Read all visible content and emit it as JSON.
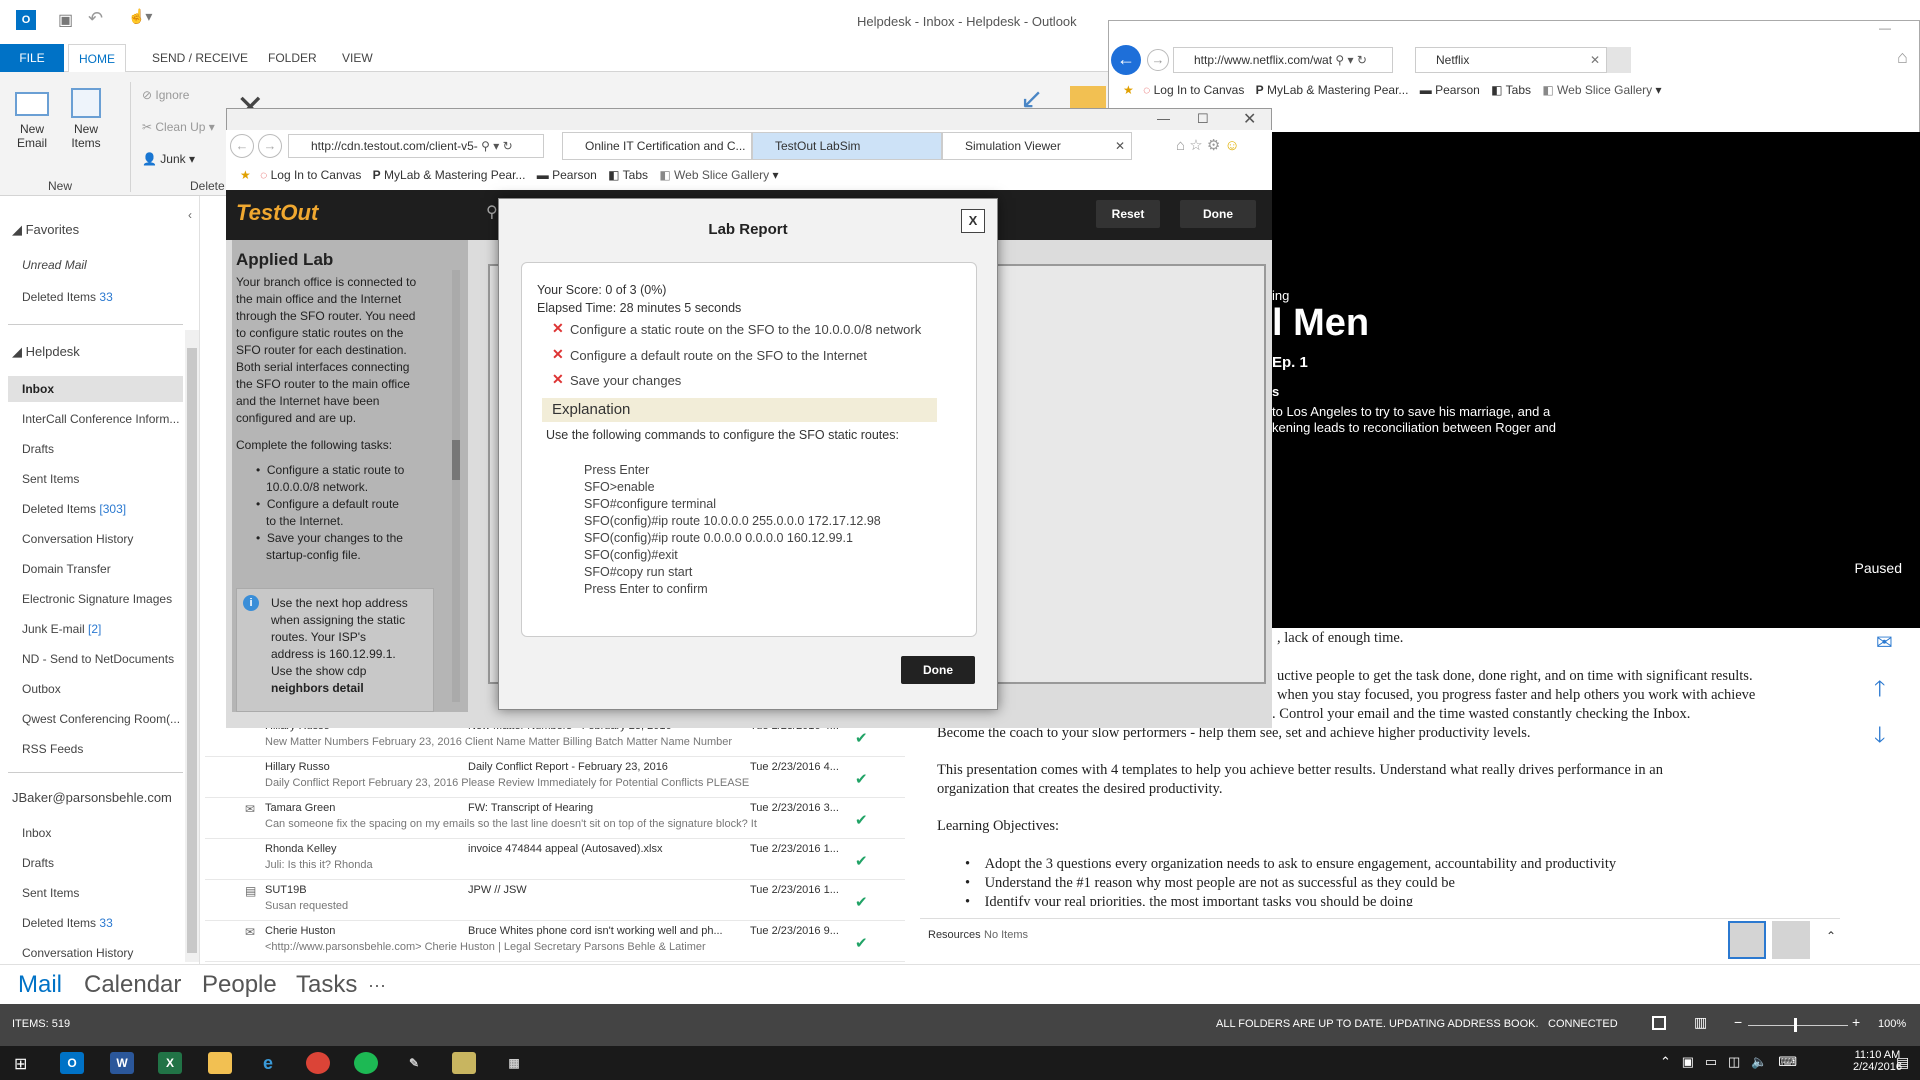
{
  "outlook": {
    "title": "Helpdesk - Inbox - Helpdesk - Outlook",
    "tabs": [
      "FILE",
      "HOME",
      "SEND / RECEIVE",
      "FOLDER",
      "VIEW"
    ],
    "ribbon": {
      "new_email": "New Email",
      "new_items": "New Items",
      "new_group": "New",
      "ignore": "Ignore",
      "clean_up": "Clean Up",
      "junk": "Junk",
      "delete_group": "Delete"
    },
    "nav": {
      "favorites": "Favorites",
      "unread": "Unread Mail",
      "deleted_fav": "Deleted Items",
      "deleted_fav_count": "33",
      "helpdesk": "Helpdesk",
      "inbox": "Inbox",
      "intercall": "InterCall Conference Inform...",
      "drafts": "Drafts",
      "sent": "Sent Items",
      "deleted": "Deleted Items",
      "deleted_count": "[303]",
      "conv": "Conversation History",
      "domain": "Domain Transfer",
      "esig": "Electronic Signature Images",
      "junk": "Junk E-mail",
      "junk_count": "[2]",
      "nd": "ND - Send to NetDocuments",
      "outbox": "Outbox",
      "qwest": "Qwest Conferencing Room(...",
      "rss": "RSS Feeds",
      "account": "JBaker@parsonsbehle.com",
      "a_inbox": "Inbox",
      "a_drafts": "Drafts",
      "a_sent": "Sent Items",
      "a_deleted": "Deleted Items",
      "a_deleted_count": "33",
      "a_conv": "Conversation History"
    },
    "mails": [
      {
        "from": "Hillary Russo",
        "subject": "New Matter Numbers - February 23, 2016",
        "date": "Tue 2/23/2016 4...",
        "preview": "New Matter Numbers  February 23, 2016  Client Name  Matter  Billing  Batch  Matter Name  Number"
      },
      {
        "from": "Hillary Russo",
        "subject": "Daily Conflict Report - February 23, 2016",
        "date": "Tue 2/23/2016 4...",
        "preview": "Daily Conflict Report  February 23, 2016  Please Review Immediately for Potential Conflicts  PLEASE"
      },
      {
        "from": "Tamara Green",
        "subject": "FW: Transcript of Hearing",
        "date": "Tue 2/23/2016 3...",
        "preview": "Can someone fix the spacing on my emails so the last line doesn't sit on top of the signature block?  It"
      },
      {
        "from": "Rhonda Kelley",
        "subject": "invoice 474844 appeal (Autosaved).xlsx",
        "date": "Tue 2/23/2016 1...",
        "preview": "Juli:  Is this it?  Rhonda"
      },
      {
        "from": "SUT19B",
        "subject": "JPW // JSW",
        "date": "Tue 2/23/2016 1...",
        "preview": "Susan requested"
      },
      {
        "from": "Cherie Huston",
        "subject": "Bruce Whites phone cord isn't working well and ph...",
        "date": "Tue 2/23/2016 9...",
        "preview": "<http://www.parsonsbehle.com>  Cherie Huston | Legal Secretary  Parsons Behle & Latimer"
      }
    ],
    "reading": [
      ", lack of enough time.",
      "uctive people to get the task done, done right, and on time with significant results.",
      "when you stay focused, you progress faster and help others you work with achieve",
      "their goals sooner too. Go from overtime to done, on time. Control your email and the time wasted constantly checking the Inbox.",
      "Become the coach to your slow performers - help them see, set and achieve higher productivity levels.",
      "This presentation comes with 4 templates to help you achieve better results. Understand what really drives performance in an",
      "organization that creates the desired productivity.",
      "Learning Objectives:",
      "Adopt the 3 questions every organization needs to ask to ensure engagement, accountability and productivity",
      "Understand the #1 reason why most people are not as successful as they could be",
      "Identify your real priorities, the most important tasks you should be doing"
    ],
    "resources": "Resources",
    "no_items": "No Items",
    "bottom_nav": [
      "Mail",
      "Calendar",
      "People",
      "Tasks",
      "···"
    ],
    "status": {
      "items": "ITEMS: 519",
      "sync": "ALL FOLDERS ARE UP TO DATE.  UPDATING ADDRESS BOOK.",
      "conn": "CONNECTED",
      "zoom": "100%"
    }
  },
  "netflix": {
    "url": "http://www.netflix.com/wat",
    "tab": "Netflix",
    "fav": [
      "Log In to Canvas",
      "MyLab & Mastering  Pear...",
      "Pearson",
      "Tabs",
      "Web Slice Gallery"
    ],
    "ing": "ing",
    "title": "l Men",
    "ep": "Ep. 1",
    "s": "s",
    "desc1": "to Los Angeles to try to save his marriage, and a",
    "desc2": "kening leads to reconciliation between Roger and",
    "paused": "Paused"
  },
  "ie": {
    "url": "http://cdn.testout.com/client-v5-",
    "tabs": [
      "Online IT Certification and C...",
      "TestOut LabSim",
      "Simulation Viewer"
    ],
    "fav": [
      "Log In to Canvas",
      "MyLab & Mastering  Pear...",
      "Pearson",
      "Tabs",
      "Web Slice Gallery"
    ]
  },
  "testout": {
    "logo": "TestOut",
    "reset": "Reset",
    "done": "Done",
    "applied_title": "Applied Lab",
    "applied_text": [
      "Your branch office is connected to",
      "the main office and the Internet",
      "through the SFO router. You need",
      "to configure static routes on the",
      "SFO router for each destination.",
      "Both serial interfaces connecting",
      "the SFO router to the main office",
      "and the Internet have been",
      "configured and are up."
    ],
    "complete": "Complete the following tasks:",
    "bullets": [
      [
        "Configure a static route to",
        "10.0.0.0/8 network."
      ],
      [
        "Configure a default route",
        "to the Internet."
      ],
      [
        "Save your changes to the",
        "startup-config file."
      ]
    ],
    "hint": [
      "Use the next hop address",
      "when assigning the static",
      "routes. Your ISP's",
      "address is 160.12.99.1.",
      "Use the show cdp",
      "neighbors detail"
    ]
  },
  "report": {
    "title": "Lab Report",
    "close": "X",
    "score": "Your Score: 0 of 3 (0%)",
    "elapsed": "Elapsed Time: 28 minutes 5 seconds",
    "tasks": [
      "Configure a static route on the SFO to the 10.0.0.0/8 network",
      "Configure a default route on the SFO to the Internet",
      "Save your changes"
    ],
    "explanation": "Explanation",
    "intro": "Use the following commands to configure the SFO static routes:",
    "commands": [
      "Press Enter",
      "SFO>enable",
      "SFO#configure terminal",
      "SFO(config)#ip route 10.0.0.0 255.0.0.0 172.17.12.98",
      "SFO(config)#ip route 0.0.0.0 0.0.0.0 160.12.99.1",
      "SFO(config)#exit",
      "SFO#copy run start",
      "Press Enter to confirm"
    ],
    "done": "Done"
  },
  "taskbar": {
    "time": "11:10 AM",
    "date": "2/24/2016"
  }
}
